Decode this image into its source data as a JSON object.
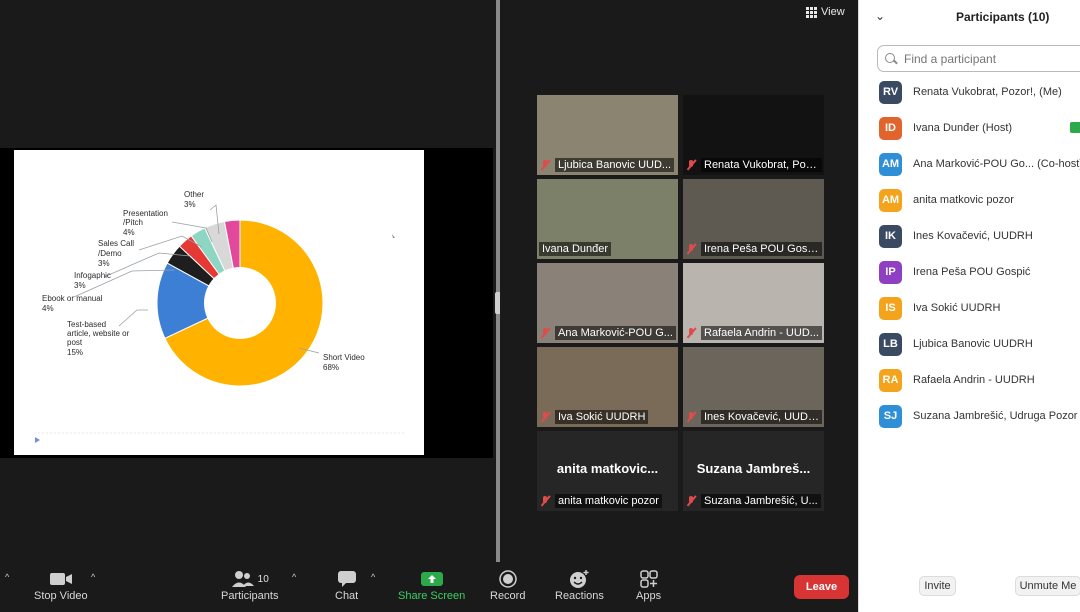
{
  "slide": {
    "chart_data": {
      "type": "pie",
      "slices": [
        {
          "label": "Short Video",
          "value": 68,
          "display": "68%",
          "color": "#FFB300"
        },
        {
          "label": "Test-based article, website or post",
          "value": 15,
          "display": "15%",
          "color": "#3E7FD6"
        },
        {
          "label": "Ebook or manual",
          "value": 4,
          "display": "4%",
          "color": "#1E1E1E"
        },
        {
          "label": "Infogaphic",
          "value": 3,
          "display": "3%",
          "color": "#E53935"
        },
        {
          "label": "Sales Call /Demo",
          "value": 3,
          "display": "3%",
          "color": "#8DD6C4"
        },
        {
          "label": "Presentation /Pitch",
          "value": 4,
          "display": "4%",
          "color": "#D8D8D8"
        },
        {
          "label": "Other",
          "value": 3,
          "display": "3%",
          "color": "#E2499A"
        }
      ],
      "donut": true
    },
    "labels": {
      "other": "Other",
      "other_pct": "3%",
      "presentation_1": "Presentation",
      "presentation_2": "/Pitch",
      "presentation_pct": "4%",
      "sales_1": "Sales Call",
      "sales_2": "/Demo",
      "sales_pct": "3%",
      "infogaphic": "Infogaphic",
      "infogaphic_pct": "3%",
      "ebook": "Ebook or manual",
      "ebook_pct": "4%",
      "test_1": "Test-based",
      "test_2": "article, website or",
      "test_3": "post",
      "test_pct": "15%",
      "short": "Short Video",
      "short_pct": "68%"
    }
  },
  "gallery": {
    "view_label": "View",
    "tiles": [
      {
        "name": "Ljubica Banovic UUD...",
        "muted": true,
        "color": "#8b8470"
      },
      {
        "name": "Renata Vukobrat, Poz...",
        "muted": true,
        "color": "#121212"
      },
      {
        "name": "Ivana Dunđer",
        "muted": false,
        "active": true,
        "color": "#7d8068"
      },
      {
        "name": "Irena Peša POU Gospić",
        "muted": true,
        "color": "#5e5a52"
      },
      {
        "name": "Ana Marković-POU G...",
        "muted": true,
        "color": "#8a8278"
      },
      {
        "name": "Rafaela Andrin - UUD...",
        "muted": true,
        "color": "#b9b4ad"
      },
      {
        "name": "Iva Sokić UUDRH",
        "muted": true,
        "color": "#7a6a58"
      },
      {
        "name": "Ines Kovačević, UUDRH",
        "muted": true,
        "color": "#6b655c"
      },
      {
        "name": "anita matkovic pozor",
        "muted": true,
        "big": "anita  matkovic...",
        "color": "#262626"
      },
      {
        "name": "Suzana Jambrešić, U...",
        "muted": true,
        "big": "Suzana  Jambreš...",
        "color": "#262626"
      }
    ]
  },
  "toolbar": {
    "stop_video": "Stop Video",
    "participants": "Participants",
    "participants_count": "10",
    "chat": "Chat",
    "share_screen": "Share Screen",
    "record": "Record",
    "reactions": "Reactions",
    "apps": "Apps",
    "leave": "Leave"
  },
  "panel": {
    "title": "Participants (10)",
    "search_placeholder": "Find a participant",
    "participants": [
      {
        "initials": "RV",
        "name": "Renata Vukobrat, Pozor!, (Me)",
        "color": "#3b4a63"
      },
      {
        "initials": "ID",
        "name": "Ivana Dunđer (Host)",
        "color": "#e0642b"
      },
      {
        "initials": "AM",
        "name": "Ana Marković-POU Go... (Co-host)",
        "color": "#2f8fd6"
      },
      {
        "initials": "AM",
        "name": "anita matkovic pozor",
        "color": "#f3a41c"
      },
      {
        "initials": "IK",
        "name": "Ines Kovačević, UUDRH",
        "color": "#3b4a63"
      },
      {
        "initials": "IP",
        "name": "Irena Peša POU Gospić",
        "color": "#8e3fc2"
      },
      {
        "initials": "IS",
        "name": "Iva Sokić UUDRH",
        "color": "#f3a41c"
      },
      {
        "initials": "LB",
        "name": "Ljubica Banovic UUDRH",
        "color": "#3b4a63"
      },
      {
        "initials": "RA",
        "name": "Rafaela Andrin - UUDRH",
        "color": "#f3a41c"
      },
      {
        "initials": "SJ",
        "name": "Suzana Jambrešić, Udruga Pozor",
        "color": "#2f8fd6"
      }
    ],
    "invite": "Invite",
    "unmute_me": "Unmute Me"
  }
}
